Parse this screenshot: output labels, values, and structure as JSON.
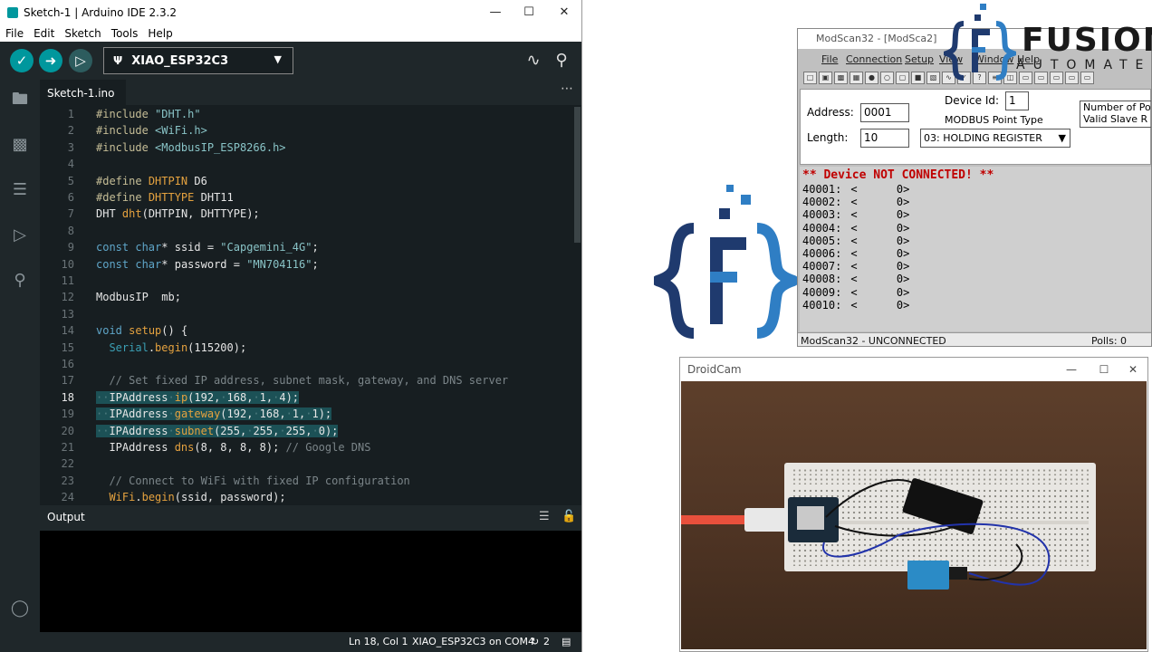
{
  "ide": {
    "window_title": "Sketch-1 | Arduino IDE 2.3.2",
    "menu": [
      "File",
      "Edit",
      "Sketch",
      "Tools",
      "Help"
    ],
    "board": "XIAO_ESP32C3",
    "tab": "Sketch-1.ino",
    "code": [
      {
        "n": "1",
        "html": "<span class='k-pre'>#include</span> <span class='k-str'>\"DHT.h\"</span>"
      },
      {
        "n": "2",
        "html": "<span class='k-pre'>#include</span> <span class='k-str'>&lt;WiFi.h&gt;</span>"
      },
      {
        "n": "3",
        "html": "<span class='k-pre'>#include</span> <span class='k-str'>&lt;ModbusIP_ESP8266.h&gt;</span>"
      },
      {
        "n": "4",
        "html": ""
      },
      {
        "n": "5",
        "html": "<span class='k-pre'>#define</span> <span class='k-fn'>DHTPIN</span> D6"
      },
      {
        "n": "6",
        "html": "<span class='k-pre'>#define</span> <span class='k-fn'>DHTTYPE</span> DHT11"
      },
      {
        "n": "7",
        "html": "DHT <span class='k-fn'>dht</span>(DHTPIN, DHTTYPE);"
      },
      {
        "n": "8",
        "html": ""
      },
      {
        "n": "9",
        "html": "<span class='k-kw'>const</span> <span class='k-kw'>char</span>* ssid = <span class='k-str'>\"Capgemini_4G\"</span>;"
      },
      {
        "n": "10",
        "html": "<span class='k-kw'>const</span> <span class='k-kw'>char</span>* password = <span class='k-str'>\"MN704116\"</span>;"
      },
      {
        "n": "11",
        "html": ""
      },
      {
        "n": "12",
        "html": "ModbusIP  mb;"
      },
      {
        "n": "13",
        "html": ""
      },
      {
        "n": "14",
        "html": "<span class='k-kw'>void</span> <span class='k-fn'>setup</span>() {"
      },
      {
        "n": "15",
        "html": "  <span class='k-type'>Serial</span>.<span class='k-fn'>begin</span>(115200);"
      },
      {
        "n": "16",
        "html": ""
      },
      {
        "n": "17",
        "html": "  <span class='k-cm'>// Set fixed IP address, subnet mask, gateway, and DNS server</span>"
      },
      {
        "n": "18",
        "html": "<span class='sel'><span class='k-dot'>··</span>IPAddress<span class='k-dot'>·</span><span class='k-fn'>ip</span>(192,<span class='k-dot'>·</span>168,<span class='k-dot'>·</span>1,<span class='k-dot'>·</span>4);</span>",
        "active": true
      },
      {
        "n": "19",
        "html": "<span class='sel'><span class='k-dot'>··</span>IPAddress<span class='k-dot'>·</span><span class='k-fn'>gateway</span>(192,<span class='k-dot'>·</span>168,<span class='k-dot'>·</span>1,<span class='k-dot'>·</span>1);</span>"
      },
      {
        "n": "20",
        "html": "<span class='sel'><span class='k-dot'>··</span>IPAddress<span class='k-dot'>·</span><span class='k-fn'>subnet</span>(255,<span class='k-dot'>·</span>255,<span class='k-dot'>·</span>255,<span class='k-dot'>·</span>0);</span>"
      },
      {
        "n": "21",
        "html": "  IPAddress <span class='k-fn'>dns</span>(8, 8, 8, 8); <span class='k-cm'>// Google DNS</span>"
      },
      {
        "n": "22",
        "html": ""
      },
      {
        "n": "23",
        "html": "  <span class='k-cm'>// Connect to WiFi with fixed IP configuration</span>"
      },
      {
        "n": "24",
        "html": "  <span class='k-fn'>WiFi</span>.<span class='k-fn'>begin</span>(ssid, password);"
      }
    ],
    "output_label": "Output",
    "status": {
      "position": "Ln 18, Col 1",
      "board_port": "XIAO_ESP32C3 on COM4",
      "notifications": "2"
    }
  },
  "modscan": {
    "title": "ModScan32 - [ModSca2]",
    "menu": [
      "File",
      "Connection",
      "Setup",
      "View",
      "Window",
      "Help"
    ],
    "address_label": "Address:",
    "address_value": "0001",
    "length_label": "Length:",
    "length_value": "10",
    "device_id_label": "Device Id:",
    "device_id_value": "1",
    "point_type_label": "MODBUS Point Type",
    "point_type_value": "03: HOLDING REGISTER",
    "side_note_1": "Number of Po",
    "side_note_2": "Valid Slave R",
    "connection_msg": "** Device NOT CONNECTED! **",
    "registers": [
      {
        "addr": "40001:",
        "val": "<      0>"
      },
      {
        "addr": "40002:",
        "val": "<      0>"
      },
      {
        "addr": "40003:",
        "val": "<      0>"
      },
      {
        "addr": "40004:",
        "val": "<      0>"
      },
      {
        "addr": "40005:",
        "val": "<      0>"
      },
      {
        "addr": "40006:",
        "val": "<      0>"
      },
      {
        "addr": "40007:",
        "val": "<      0>"
      },
      {
        "addr": "40008:",
        "val": "<      0>"
      },
      {
        "addr": "40009:",
        "val": "<      0>"
      },
      {
        "addr": "40010:",
        "val": "<      0>"
      }
    ],
    "status_left": "ModScan32 - UNCONNECTED",
    "status_right": "Polls: 0"
  },
  "droidcam": {
    "title": "DroidCam"
  },
  "brand": {
    "word": "FUSION",
    "sub": "AUTOMATE"
  },
  "colors": {
    "arduino_teal": "#00979d",
    "brand_blue": "#2563a8",
    "brand_navy": "#1f3a6e",
    "modscan_error": "#c00000"
  }
}
